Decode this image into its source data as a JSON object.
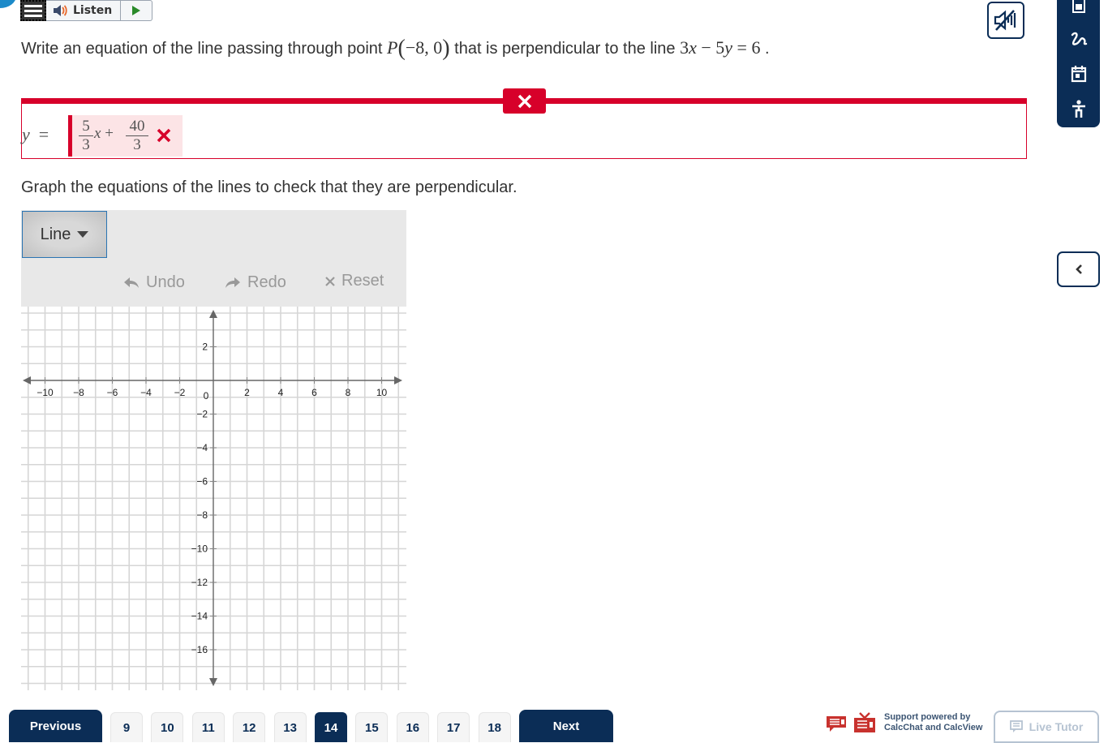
{
  "toolbar": {
    "listen_label": "Listen"
  },
  "question": {
    "prefix": "Write an equation of the line passing through point ",
    "point_name": "P",
    "point_coords": "−8, 0",
    "middle": " that is perpendicular to the line ",
    "line_eq_a": "3",
    "line_eq_var1": "x",
    "line_eq_op": " − 5",
    "line_eq_var2": "y",
    "line_eq_rhs": " = 6",
    "suffix": " ."
  },
  "answer": {
    "lhs_var": "y",
    "lhs_eq": "=",
    "slope_num": "5",
    "slope_den": "3",
    "var": "x",
    "plus": "+",
    "int_num": "40",
    "int_den": "3",
    "status": "incorrect"
  },
  "instruction": "Graph the equations of the lines to check that they are perpendicular.",
  "graph_tools": {
    "tool_select": "Line",
    "undo_label": "Undo",
    "redo_label": "Redo",
    "reset_label": "Reset"
  },
  "chart_data": {
    "type": "scatter",
    "title": "",
    "xlabel": "",
    "ylabel": "",
    "xlim": [
      -11.5,
      11.5
    ],
    "ylim": [
      -18.3,
      4.4
    ],
    "grid": true,
    "grid_step": 1,
    "x_ticks": [
      -10,
      -8,
      -6,
      -4,
      -2,
      2,
      4,
      6,
      8,
      10
    ],
    "y_ticks": [
      2,
      -2,
      -4,
      -6,
      -8,
      -10,
      -12,
      -14,
      -16
    ],
    "origin_label": "0",
    "series": []
  },
  "pagination": {
    "previous_label": "Previous",
    "next_label": "Next",
    "pages": [
      "9",
      "10",
      "11",
      "12",
      "13",
      "14",
      "15",
      "16",
      "17",
      "18"
    ],
    "current": "14"
  },
  "support": {
    "line1": "Support powered by",
    "line2": "CalcChat and CalcView",
    "live_tutor_label": "Live Tutor"
  },
  "colors": {
    "navy": "#0b2d56",
    "error_red": "#d7002a",
    "error_bg": "#fce4e6"
  }
}
